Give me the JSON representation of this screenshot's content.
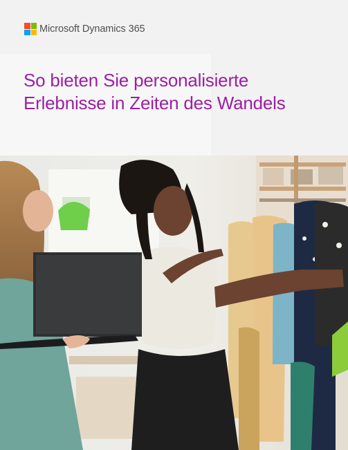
{
  "brand": {
    "logo_icon": "microsoft-logo-icon",
    "logo_colors": [
      "#f25022",
      "#7fba00",
      "#00a4ef",
      "#ffb900"
    ],
    "name": "Microsoft Dynamics 365"
  },
  "title": {
    "line1": "So bieten Sie personalisierte",
    "line2": "Erlebnisse in Zeiten des Wandels",
    "color": "#9b1fa3"
  },
  "hero": {
    "icon": "store-photo"
  }
}
